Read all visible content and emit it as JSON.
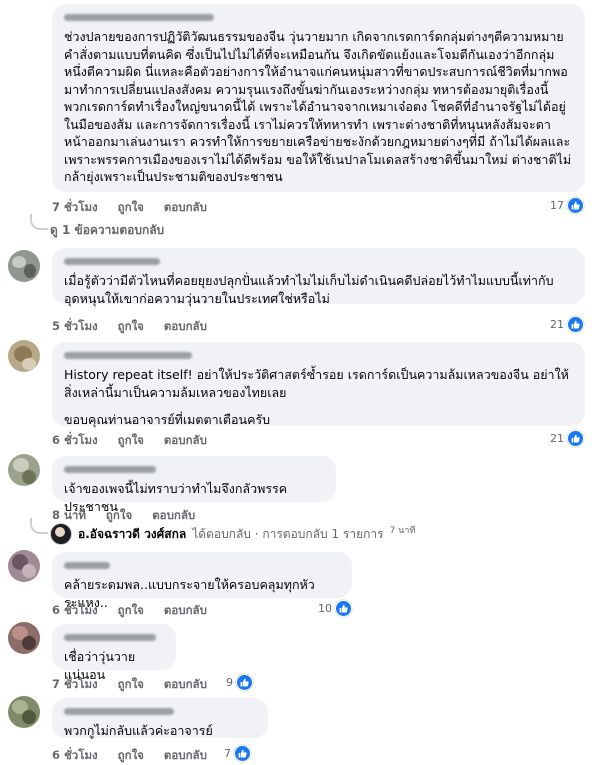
{
  "comments": [
    {
      "author": "",
      "text": "ช่วงปลายของการปฏิวัติวัฒนธรรมของจีน วุ่นวายมาก เกิดจากเรดการ์ดกลุ่มต่างๆตีความหมายคำสั่งตามแบบที่ตนคิด ซึ่งเป็นไปไม่ได้ที่จะเหมือนกัน จึงเกิดขัดแย้งและโจมตีกันเองว่าอีกกลุ่มหนึ่งตีความผิด นี่แหละคือตัวอย่างการให้อำนาจแก่คนหนุ่มสาวที่ขาดประสบการณ์ชีวิตที่มากพอมาทำการเปลี่ยนแปลงสังคม ความรุนแรงถึงขั้นฆ่ากันเองระหว่างกลุ่ม ทหารต้องมายุติเรื่องนี้ พวกเรดการ์ดทำเรื่องใหญ่ขนาดนี้ได้ เพราะได้อำนาจจากเหมาเจ๋อตง โชคดีที่อำนาจรัฐไม่ได้อยู่ในมือของส้ม และการจัดการเรื่องนี้ เราไม่ควรให้ทหารทำ เพราะต่างชาติที่หนุนหลังส้มจะดาหน้าออกมาเล่นงานเรา ควรทำให้การขยายเครือข่ายชะงักด้วยกฎหมายต่างๆที่มี ถ้าไม่ได้ผลและเพราะพรรคการเมืองของเราไม่ได้ดีพร้อม ขอให้ใช้เนปาลโมเดลสร้างชาติขึ้นมาใหม่ ต่างชาติไม่กล้ายุ่งเพราะเป็นประชามติของประชาชน",
      "time": "7 ชั่วโมง",
      "like": "ถูกใจ",
      "reply": "ตอบกลับ",
      "likes": "17"
    },
    {
      "author": "",
      "text": "เมื่อรู้ตัวว่ามีตัวไหนที่คอยยุยงปลุกปั่นแล้วทำไมไม่เก็บไม่ดำเนินคดีปล่อยไว้ทำไมแบบนี้เท่ากับอุดหนุนให้เขาก่อความวุ่นวายในประเทศใช่หรือไม่",
      "time": "5 ชั่วโมง",
      "like": "ถูกใจ",
      "reply": "ตอบกลับ",
      "likes": "21"
    },
    {
      "author": "",
      "text": "History repeat itself! อย่าให้ประวัติศาสตร์ซ้ำรอย เรดการ์ดเป็นความล้มเหลวของจีน อย่าให้สิ่งเหล่านี้มาเป็นความล้มเหลวของไทยเลย",
      "text2": "ขอบคุณท่านอาจารย์ที่เมตตาเตือนครับ",
      "time": "6 ชั่วโมง",
      "like": "ถูกใจ",
      "reply": "ตอบกลับ",
      "likes": "21"
    },
    {
      "author": "",
      "text": "เจ้าของเพจนี้ไม่ทราบว่าทำไมจึงกลัวพรรคประชาชน",
      "time": "8 นาที",
      "like": "ถูกใจ",
      "reply": "ตอบกลับ",
      "likes": ""
    },
    {
      "author": "",
      "text": "คล้ายระดมพล..แบบกระจายให้ครอบคลุมทุกหัวระแหง..",
      "time": "6 ชั่วโมง",
      "like": "ถูกใจ",
      "reply": "ตอบกลับ",
      "likes": "10"
    },
    {
      "author": "",
      "text": "เชื่อว่าวุ่นวายแน่นอน",
      "time": "7 ชั่วโมง",
      "like": "ถูกใจ",
      "reply": "ตอบกลับ",
      "likes": "9"
    },
    {
      "author": "",
      "text": "พวกกูไม่กลับแล้วค่ะอาจารย์",
      "time": "6 ชั่วโมง",
      "like": "ถูกใจ",
      "reply": "ตอบกลับ",
      "likes": "7"
    }
  ],
  "view_replies": "ดู 1 ข้อความตอบกลับ",
  "reply_summary": {
    "replier": "อ.อัจฉราวดี วงศ์สกล",
    "text": "ได้ตอบกลับ · การตอบกลับ 1 รายการ",
    "time": "7 นาที"
  },
  "colors": {
    "accent": "#1877f2",
    "bubble": "#f0f2f5",
    "meta": "#65676b"
  }
}
